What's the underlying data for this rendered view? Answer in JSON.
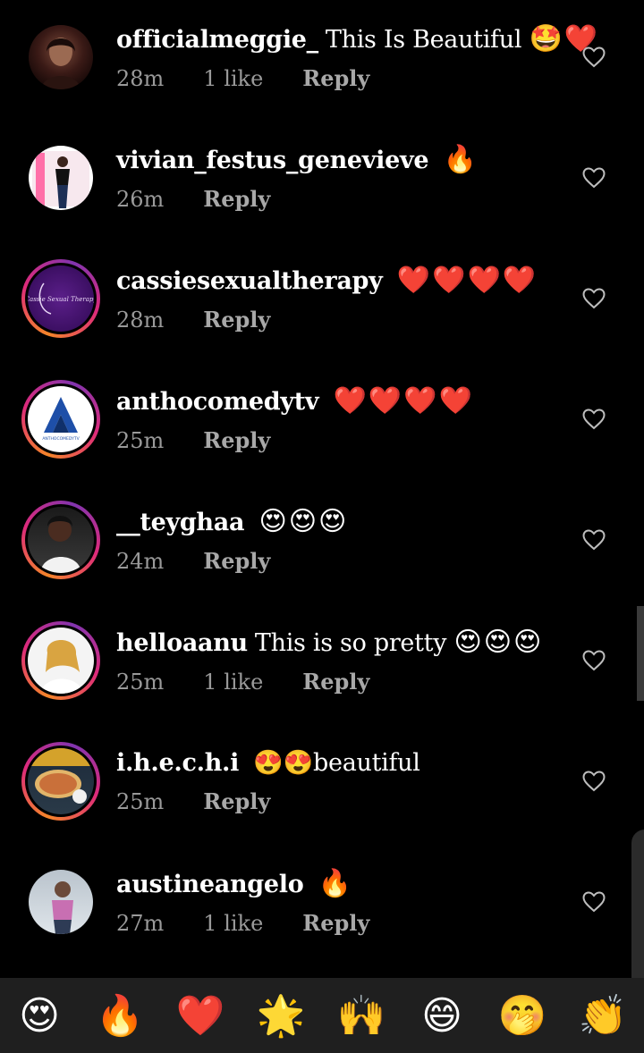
{
  "comments": [
    {
      "username": "officialmeggie_",
      "text": "This Is Beautiful",
      "emoji": "🤩❤️",
      "time": "28m",
      "likes": "1 like",
      "reply": "Reply"
    },
    {
      "username": "vivian_festus_genevieve",
      "text": "",
      "emoji": "🔥",
      "time": "26m",
      "likes": "",
      "reply": "Reply"
    },
    {
      "username": "cassiesexualtherapy",
      "text": "",
      "emoji": "❤️❤️❤️❤️",
      "time": "28m",
      "likes": "",
      "reply": "Reply"
    },
    {
      "username": "anthocomedytv",
      "text": "",
      "emoji": "❤️❤️❤️❤️",
      "time": "25m",
      "likes": "",
      "reply": "Reply"
    },
    {
      "username": "__teyghaa",
      "text": "",
      "emoji": "😍😍😍",
      "time": "24m",
      "likes": "",
      "reply": "Reply"
    },
    {
      "username": "helloaanu",
      "text": "This is so pretty",
      "emoji": "😍😍😍",
      "time": "25m",
      "likes": "1 like",
      "reply": "Reply"
    },
    {
      "username": "i.h.e.c.h.i",
      "text": "",
      "emoji": "😍😍beautiful",
      "time": "25m",
      "likes": "",
      "reply": "Reply"
    },
    {
      "username": "austineangelo",
      "text": "",
      "emoji": "🔥",
      "time": "27m",
      "likes": "1 like",
      "reply": "Reply"
    }
  ],
  "avatars": {
    "cassie_text": "Cassie Sexual Therapy",
    "antho_text": "ANTHOCOMEDYTV"
  },
  "emoji_bar": [
    "😍",
    "🔥",
    "❤️",
    "🌟",
    "🙌",
    "😄",
    "🤭",
    "👏"
  ],
  "colors": {
    "background": "#000000",
    "meta_text": "#9a9a9a",
    "emoji_bar_bg": "#1f1f1f",
    "story_ring": "#dd2a7b"
  }
}
